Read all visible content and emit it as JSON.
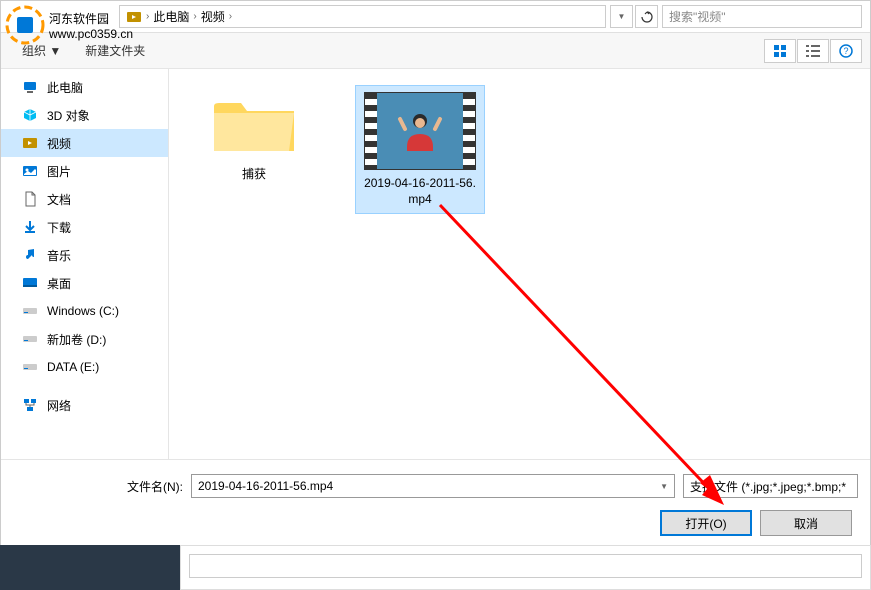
{
  "watermark": {
    "title": "河东软件园",
    "url": "www.pc0359.cn"
  },
  "breadcrumb": {
    "parts": [
      "此电脑",
      "视频"
    ]
  },
  "search": {
    "placeholder": "搜索\"视频\""
  },
  "toolbar": {
    "organize": "组织 ▼",
    "new_folder": "新建文件夹"
  },
  "sidebar": {
    "items": [
      {
        "label": "此电脑",
        "icon": "computer",
        "color": "#0078d7"
      },
      {
        "label": "3D 对象",
        "icon": "3d",
        "color": "#00bcf2"
      },
      {
        "label": "视频",
        "icon": "video",
        "color": "#c29100",
        "active": true
      },
      {
        "label": "图片",
        "icon": "pictures",
        "color": "#0078d7"
      },
      {
        "label": "文档",
        "icon": "documents",
        "color": "#555"
      },
      {
        "label": "下载",
        "icon": "downloads",
        "color": "#0078d7"
      },
      {
        "label": "音乐",
        "icon": "music",
        "color": "#0078d7"
      },
      {
        "label": "桌面",
        "icon": "desktop",
        "color": "#0078d7"
      },
      {
        "label": "Windows (C:)",
        "icon": "drive",
        "color": "#888"
      },
      {
        "label": "新加卷 (D:)",
        "icon": "drive",
        "color": "#888"
      },
      {
        "label": "DATA (E:)",
        "icon": "drive",
        "color": "#888"
      },
      {
        "label": "网络",
        "icon": "network",
        "color": "#0078d7"
      }
    ]
  },
  "files": [
    {
      "name": "捕获",
      "type": "folder"
    },
    {
      "name": "2019-04-16-2011-56.mp4",
      "type": "video",
      "selected": true
    }
  ],
  "bottom": {
    "filename_label": "文件名(N):",
    "filename_value": "2019-04-16-2011-56.mp4",
    "filetype": "支持文件 (*.jpg;*.jpeg;*.bmp;*",
    "open": "打开(O)",
    "cancel": "取消"
  }
}
